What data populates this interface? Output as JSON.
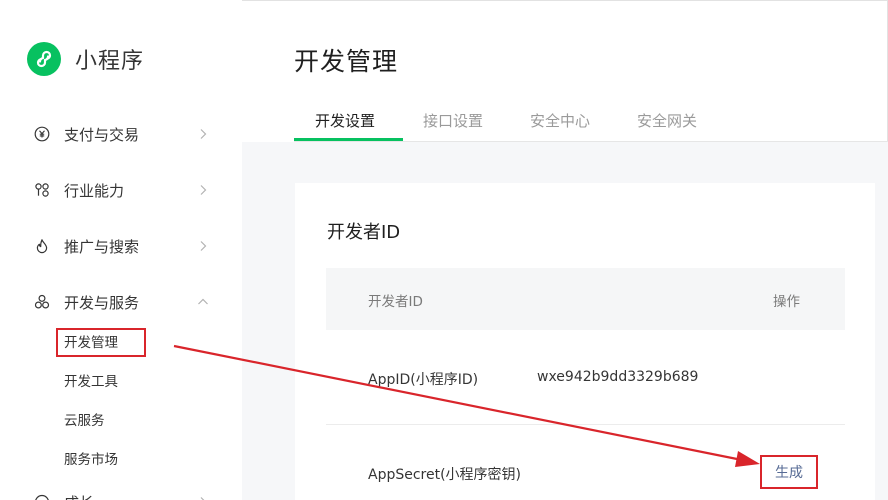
{
  "app": {
    "name": "小程序",
    "brand_color": "#07c160"
  },
  "sidebar": {
    "items": [
      {
        "label": "支付与交易",
        "icon": "yuan-circle-icon",
        "chevron": "right"
      },
      {
        "label": "行业能力",
        "icon": "link-nodes-icon",
        "chevron": "right"
      },
      {
        "label": "推广与搜索",
        "icon": "flame-icon",
        "chevron": "right"
      },
      {
        "label": "开发与服务",
        "icon": "cluster-icon",
        "chevron": "up"
      }
    ],
    "sub_items": [
      "开发管理",
      "开发工具",
      "云服务",
      "服务市场"
    ],
    "next_item_partial": "成长"
  },
  "main": {
    "title": "开发管理",
    "tabs": [
      {
        "label": "开发设置",
        "active": true
      },
      {
        "label": "接口设置",
        "active": false
      },
      {
        "label": "安全中心",
        "active": false
      },
      {
        "label": "安全网关",
        "active": false
      }
    ],
    "section_title": "开发者ID",
    "table": {
      "headers": [
        "开发者ID",
        "操作"
      ],
      "rows": [
        {
          "label": "AppID(小程序ID)",
          "value": "wxe942b9dd3329b689",
          "action": ""
        },
        {
          "label": "AppSecret(小程序密钥)",
          "value": "",
          "action": "生成"
        }
      ]
    }
  },
  "colors": {
    "accent": "#07c160",
    "annotation_red": "#d9252b",
    "link": "#576b95"
  }
}
